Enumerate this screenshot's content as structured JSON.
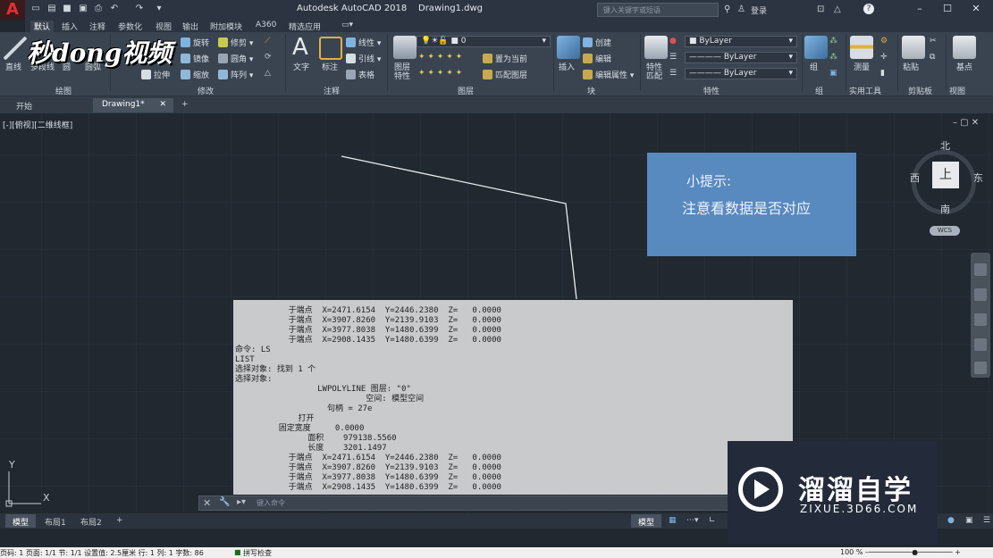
{
  "window": {
    "title": "Autodesk AutoCAD 2018",
    "doc": "Drawing1.dwg",
    "search_placeholder": "键入关键字或短语",
    "login": "登录"
  },
  "tabs": [
    "默认",
    "插入",
    "注释",
    "参数化",
    "视图",
    "输出",
    "附加模块",
    "A360",
    "精选应用"
  ],
  "ribbon": {
    "draw": {
      "line": "直线",
      "polyline": "多段线",
      "circle": "圆",
      "arc": "圆弧",
      "label": "绘图"
    },
    "modify": {
      "rotate": "旋转",
      "trim": "修剪",
      "mirror": "镜像",
      "fillet": "圆角",
      "stretch": "拉伸",
      "scale": "缩放",
      "array": "阵列",
      "label": "修改"
    },
    "annot": {
      "text": "文字",
      "dim": "标注",
      "linear": "线性",
      "leader": "引线",
      "table": "表格",
      "label": "注释"
    },
    "layers": {
      "props": "图层",
      "props2": "特性",
      "layer_value": "0",
      "make_current": "置为当前",
      "match": "匹配图层",
      "label": "图层"
    },
    "block": {
      "insert": "插入",
      "create": "创建",
      "edit": "编辑",
      "editattr": "编辑属性",
      "label": "块"
    },
    "props": {
      "match": "特性",
      "match2": "匹配",
      "bylayer1": "ByLayer",
      "bylayer2": "ByLayer",
      "bylayer3": "ByLayer",
      "label": "特性"
    },
    "groups": {
      "group": "组",
      "label": "组"
    },
    "utils": {
      "measure": "测量",
      "label": "实用工具"
    },
    "clip": {
      "paste": "粘贴",
      "label": "剪贴板"
    },
    "view": {
      "base": "基点",
      "label": "视图"
    }
  },
  "doctabs": {
    "start": "开始",
    "drawing": "Drawing1*"
  },
  "viewport_label": "[-][俯视][二维线框]",
  "hint": {
    "title": "小提示:",
    "body": "注意看数据是否对应"
  },
  "viewcube": {
    "north": "北",
    "south": "南",
    "east": "东",
    "west": "西",
    "top": "上",
    "wcs": "WCS"
  },
  "textwindow": [
    "           于端点  X=2471.6154  Y=2446.2380  Z=   0.0000",
    "           于端点  X=3907.8260  Y=2139.9103  Z=   0.0000",
    "           于端点  X=3977.8038  Y=1480.6399  Z=   0.0000",
    "           于端点  X=2908.1435  Y=1480.6399  Z=   0.0000",
    "命令: LS",
    "LIST",
    "选择对象: 找到 1 个",
    "选择对象:",
    "                 LWPOLYLINE 图层: \"0\"",
    "                           空间: 模型空间",
    "                   句柄 = 27e",
    "             打开",
    "         固定宽度     0.0000",
    "               面积    979138.5560",
    "               长度    3201.1497",
    "           于端点  X=2471.6154  Y=2446.2380  Z=   0.0000",
    "           于端点  X=3907.8260  Y=2139.9103  Z=   0.0000",
    "           于端点  X=3977.8038  Y=1480.6399  Z=   0.0000",
    "           于端点  X=2908.1435  Y=1480.6399  Z=   0.0000"
  ],
  "cmd_placeholder": "键入命令",
  "layout_tabs": [
    "模型",
    "布局1",
    "布局2"
  ],
  "model_btn": "模型",
  "status": {
    "left": "页码: 1  页面: 1/1  节: 1/1  设置值: 2.5厘米  行: 1  列: 1  字数: 86",
    "spell": "拼写检查",
    "zoom": "100 %"
  },
  "watermark": {
    "title": "溜溜自学",
    "url": "ZIXUE.3D66.COM"
  },
  "tl_logo": "秒dong视频",
  "axis": {
    "y": "Y",
    "x": "X"
  }
}
